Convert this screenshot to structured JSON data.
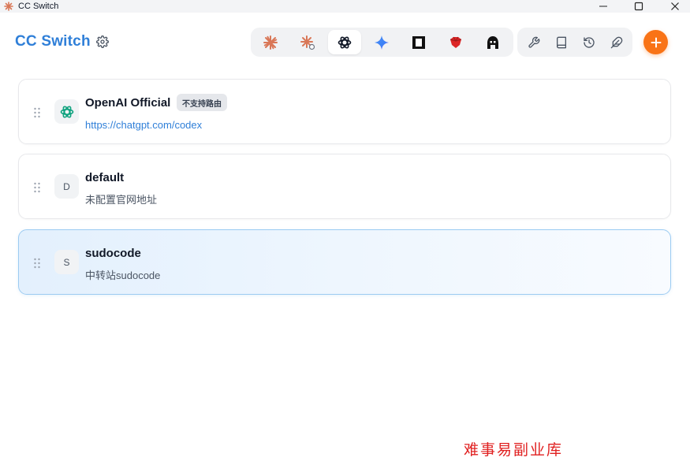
{
  "window": {
    "title": "CC Switch"
  },
  "header": {
    "title": "CC Switch",
    "settings_icon": "gear-icon"
  },
  "app_switcher": {
    "items": [
      {
        "name": "claude",
        "icon": "claude-starburst-icon",
        "active": false
      },
      {
        "name": "claude-variant",
        "icon": "claude-starburst-badge-icon",
        "active": false
      },
      {
        "name": "codex",
        "icon": "openai-icon",
        "active": true
      },
      {
        "name": "gemini",
        "icon": "gemini-sparkle-icon",
        "active": false
      },
      {
        "name": "app-5",
        "icon": "square-frame-icon",
        "active": false
      },
      {
        "name": "app-6",
        "icon": "red-gem-icon",
        "active": false
      },
      {
        "name": "app-7",
        "icon": "character-head-icon",
        "active": false
      }
    ]
  },
  "toolbar": {
    "items": [
      {
        "name": "tools",
        "icon": "wrench-icon"
      },
      {
        "name": "library",
        "icon": "book-icon"
      },
      {
        "name": "history",
        "icon": "history-icon"
      },
      {
        "name": "skills",
        "icon": "feather-icon"
      }
    ],
    "add_icon": "plus-icon"
  },
  "providers": [
    {
      "name": "OpenAI Official",
      "badge": "不支持路由",
      "subtitle": "https://chatgpt.com/codex",
      "subtitle_type": "link",
      "avatar_icon": "openai-icon",
      "avatar_letter": "",
      "active": false
    },
    {
      "name": "default",
      "badge": "",
      "subtitle": "未配置官网地址",
      "subtitle_type": "muted",
      "avatar_icon": "",
      "avatar_letter": "D",
      "active": false
    },
    {
      "name": "sudocode",
      "badge": "",
      "subtitle": "中转站sudocode",
      "subtitle_type": "muted",
      "avatar_icon": "",
      "avatar_letter": "S",
      "active": true
    }
  ],
  "watermark": "难事易副业库",
  "colors": {
    "brand": "#2f7fd8",
    "accent": "#f97316",
    "active_card_border": "#9ccbf2",
    "watermark": "#e02020"
  }
}
